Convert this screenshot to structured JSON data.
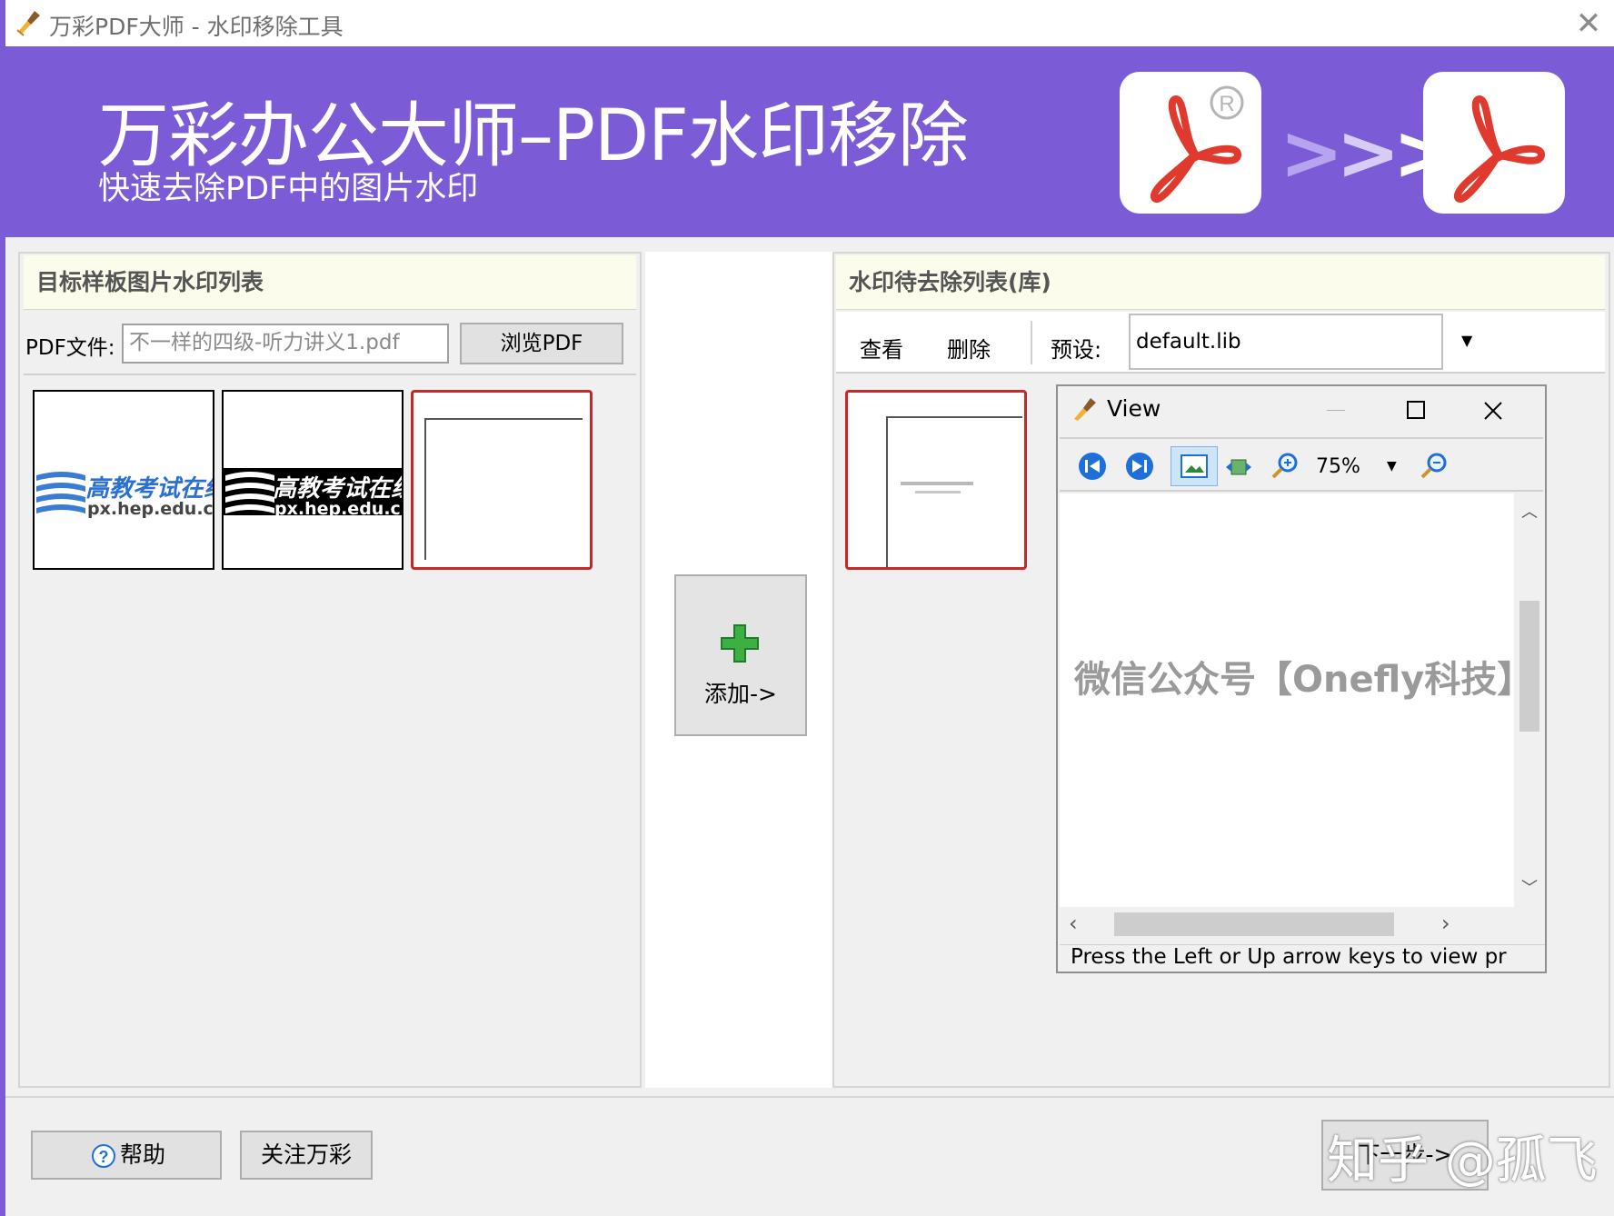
{
  "window": {
    "title": "万彩PDF大师 - 水印移除工具",
    "close_glyph": "✕",
    "app_icon": "broom-icon",
    "accent_color": "#7b5bd6"
  },
  "banner": {
    "title": "万彩办公大师–PDF水印移除",
    "subtitle": "快速去除PDF中的图片水印",
    "arrows": ">>>",
    "source_icon": "pdf-registered-icon",
    "target_icon": "pdf-clean-icon"
  },
  "left_panel": {
    "header": "目标样板图片水印列表",
    "pdf_label": "PDF文件:",
    "pdf_value": "不一样的四级-听力讲义1.pdf",
    "browse_label": "浏览PDF",
    "thumbs": [
      {
        "line1": "高教考试在线",
        "line2": "px.hep.edu.cn",
        "style": "color"
      },
      {
        "line1": "高教考试在线",
        "line2": "px.hep.edu.cn",
        "style": "inverted"
      },
      {
        "line1": "",
        "line2": "",
        "style": "blank"
      }
    ]
  },
  "add_button": {
    "label": "添加->",
    "icon": "plus-icon"
  },
  "right_panel": {
    "header": "水印待去除列表(库)",
    "view_label": "查看",
    "delete_label": "删除",
    "preset_label": "预设:",
    "preset_value": "default.lib"
  },
  "viewer": {
    "title": "View",
    "zoom": "75%",
    "watermark_text": "微信公众号【Onefly科技】",
    "status": "Press the Left or Up arrow keys to view pr"
  },
  "footer": {
    "help_label": "帮助",
    "follow_label": "关注万彩",
    "next_label": "下一步->"
  },
  "overlay": {
    "zhihu_mark": "知乎 @孤飞"
  }
}
